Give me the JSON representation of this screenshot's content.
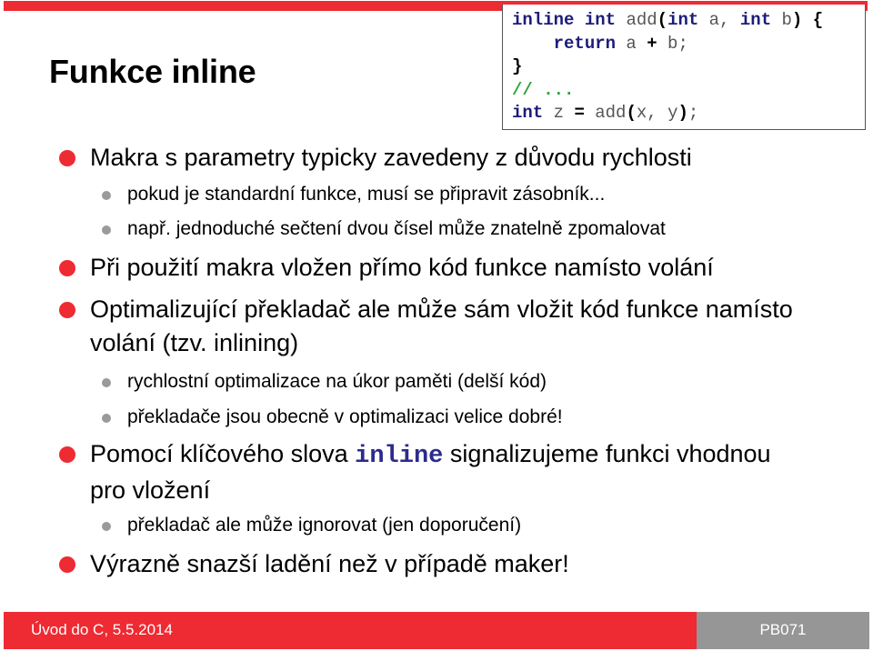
{
  "slide": {
    "title": "Funkce inline",
    "accent_color": "#ee2a33",
    "secondary_color": "#969696"
  },
  "code_box": {
    "lines": [
      [
        {
          "t": "kw",
          "v": "inline"
        },
        {
          "t": "id",
          "v": " "
        },
        {
          "t": "kw",
          "v": "int"
        },
        {
          "t": "id",
          "v": " add"
        },
        {
          "t": "pn",
          "v": "("
        },
        {
          "t": "kw",
          "v": "int"
        },
        {
          "t": "id",
          "v": " a, "
        },
        {
          "t": "kw",
          "v": "int"
        },
        {
          "t": "id",
          "v": " b"
        },
        {
          "t": "pn",
          "v": ")"
        },
        {
          "t": "id",
          "v": " "
        },
        {
          "t": "pn",
          "v": "{"
        }
      ],
      [
        {
          "t": "id",
          "v": "    "
        },
        {
          "t": "kw",
          "v": "return"
        },
        {
          "t": "id",
          "v": " a "
        },
        {
          "t": "pn",
          "v": "+"
        },
        {
          "t": "id",
          "v": " b;"
        }
      ],
      [
        {
          "t": "pn",
          "v": "}"
        }
      ],
      [
        {
          "t": "cm",
          "v": "// ..."
        }
      ],
      [
        {
          "t": "kw",
          "v": "int"
        },
        {
          "t": "id",
          "v": " z "
        },
        {
          "t": "pn",
          "v": "="
        },
        {
          "t": "id",
          "v": " add"
        },
        {
          "t": "pn",
          "v": "("
        },
        {
          "t": "id",
          "v": "x, y"
        },
        {
          "t": "pn",
          "v": ")"
        },
        {
          "t": "id",
          "v": ";"
        }
      ]
    ]
  },
  "bullets": {
    "b1": "Makra s parametry typicky zavedeny z důvodu rychlosti",
    "b1_1": "pokud je standardní funkce, musí se připravit zásobník...",
    "b1_2": "např. jednoduché sečtení dvou čísel může znatelně zpomalovat",
    "b2": "Při použití makra vložen přímo kód funkce namísto volání",
    "b3": "Optimalizující překladač ale může sám vložit kód funkce namísto volání (tzv. inlining)",
    "b3_1": "rychlostní optimalizace na úkor paměti (delší kód)",
    "b3_2": "překladače jsou obecně v optimalizaci velice dobré!",
    "b4_pre": "Pomocí klíčového slova ",
    "b4_code": "inline",
    "b4_post": " signalizujeme funkci vhodnou pro vložení",
    "b4_1": "překladač ale může ignorovat (jen doporučení)",
    "b5": "Výrazně snazší ladění než v případě maker!"
  },
  "footer": {
    "left": "Úvod do C, 5.5.2014",
    "right": "PB071"
  }
}
